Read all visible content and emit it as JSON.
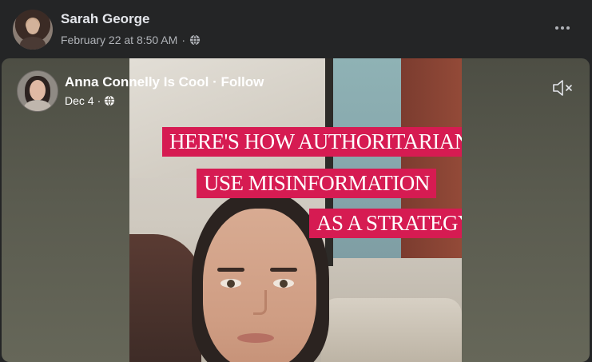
{
  "post": {
    "author": "Sarah George",
    "date": "February 22 at 8:50 AM",
    "separator": "·",
    "privacy_icon": "globe-icon",
    "more_icon": "more-horizontal-icon"
  },
  "shared_video": {
    "page_name": "Anna Connelly Is Cool",
    "dot": " · ",
    "follow_label": "Follow",
    "date": "Dec 4",
    "separator": "·",
    "privacy_icon": "globe-icon",
    "mute_icon": "speaker-muted-icon",
    "captions": [
      "HERE'S HOW AUTHORITARIANS",
      "USE MISINFORMATION",
      "AS A STRATEGY"
    ]
  },
  "colors": {
    "background": "#242526",
    "caption_bg": "#d61b52",
    "secondary_text": "#b0b3b8"
  }
}
